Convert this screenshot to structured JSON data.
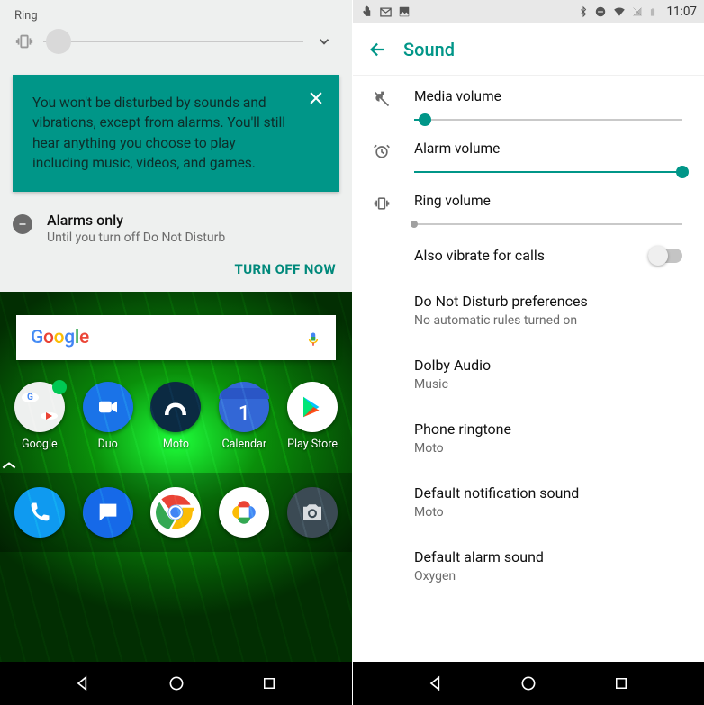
{
  "left": {
    "ring": {
      "label": "Ring",
      "value": 6
    },
    "dndCard": {
      "text": "You won't be disturbed by sounds and vibrations, except from alarms. You'll still hear anything you choose to play including music, videos, and games."
    },
    "alarmsOnly": {
      "title": "Alarms only",
      "sub": "Until you turn off Do Not Disturb"
    },
    "turnOff": "TURN OFF NOW",
    "search": {
      "logo": "Google"
    },
    "apps": [
      {
        "label": "Google"
      },
      {
        "label": "Duo"
      },
      {
        "label": "Moto"
      },
      {
        "label": "Calendar"
      },
      {
        "label": "Play Store"
      }
    ],
    "dock": [
      "phone",
      "messages",
      "chrome",
      "photos",
      "camera"
    ]
  },
  "right": {
    "status": {
      "time": "11:07"
    },
    "header": {
      "title": "Sound"
    },
    "volumes": {
      "media": {
        "title": "Media volume",
        "value": 4
      },
      "alarm": {
        "title": "Alarm volume",
        "value": 100
      },
      "ring": {
        "title": "Ring volume",
        "value": 0
      }
    },
    "vibrateCalls": {
      "title": "Also vibrate for calls",
      "on": false
    },
    "items": [
      {
        "title": "Do Not Disturb preferences",
        "sub": "No automatic rules turned on"
      },
      {
        "title": "Dolby Audio",
        "sub": "Music"
      },
      {
        "title": "Phone ringtone",
        "sub": "Moto"
      },
      {
        "title": "Default notification sound",
        "sub": "Moto"
      },
      {
        "title": "Default alarm sound",
        "sub": "Oxygen"
      }
    ]
  }
}
